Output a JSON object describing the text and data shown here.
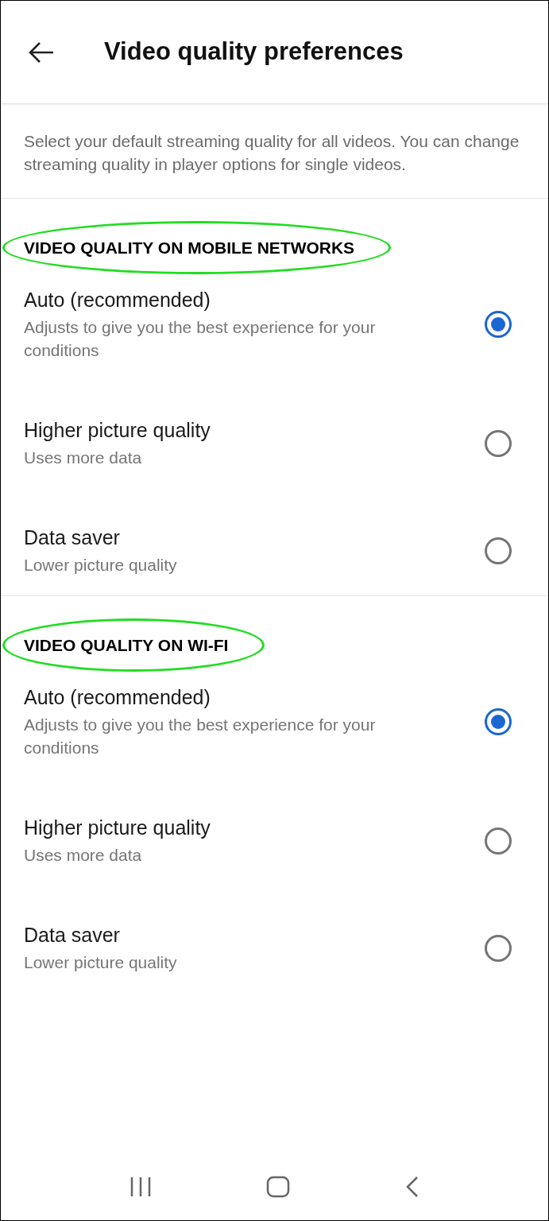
{
  "header": {
    "title": "Video quality preferences"
  },
  "description": "Select your default streaming quality for all videos. You can change streaming quality in player options for single videos.",
  "sections": [
    {
      "label": "VIDEO QUALITY ON MOBILE NETWORKS",
      "highlighted": true,
      "options": [
        {
          "title": "Auto (recommended)",
          "subtitle": "Adjusts to give you the best experience for your conditions",
          "selected": true
        },
        {
          "title": "Higher picture quality",
          "subtitle": "Uses more data",
          "selected": false
        },
        {
          "title": "Data saver",
          "subtitle": "Lower picture quality",
          "selected": false
        }
      ]
    },
    {
      "label": "VIDEO QUALITY ON WI-FI",
      "highlighted": true,
      "options": [
        {
          "title": "Auto (recommended)",
          "subtitle": "Adjusts to give you the best experience for your conditions",
          "selected": true
        },
        {
          "title": "Higher picture quality",
          "subtitle": "Uses more data",
          "selected": false
        },
        {
          "title": "Data saver",
          "subtitle": "Lower picture quality",
          "selected": false
        }
      ]
    }
  ]
}
